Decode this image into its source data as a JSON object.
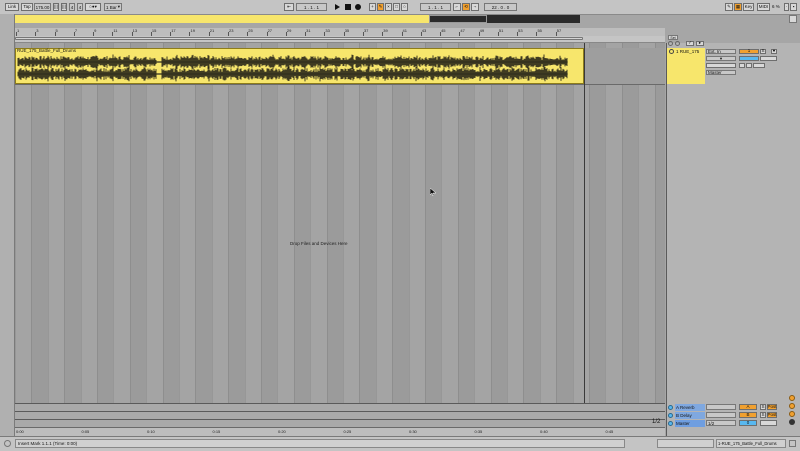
{
  "transport": {
    "link_label": "Link",
    "tap_label": "Tap",
    "tempo": "175.00",
    "sig_num": "4",
    "sig_den": "4",
    "quantize": "1 Bar",
    "position": "1 . 1 . 1",
    "loop_start": "1 . 1 . 1",
    "loop_length": "22 . 0 . 0",
    "key_label": "Key",
    "midi_label": "MIDI",
    "cpu": "6 %"
  },
  "ruler": {
    "bars": [
      "1",
      "3",
      "5",
      "7",
      "9",
      "11",
      "13",
      "15",
      "17",
      "19",
      "21",
      "23",
      "25",
      "27",
      "29",
      "31",
      "33",
      "35",
      "37",
      "39",
      "41",
      "43",
      "45",
      "47",
      "49",
      "51",
      "53",
      "55",
      "57"
    ]
  },
  "clip": {
    "name": "RUE_175_Battle_Full_Drums"
  },
  "track": {
    "name": "1 RUE_175",
    "input": "Ext. In",
    "output": "Master",
    "number": "1",
    "solo": "S"
  },
  "arrangement": {
    "drop_hint": "Drop Files and Devices Here"
  },
  "returns": [
    {
      "name": "A Reverb",
      "letter": "A"
    },
    {
      "name": "B Delay",
      "letter": "B"
    },
    {
      "name": "Master",
      "letter": "0"
    }
  ],
  "master": {
    "cue": "1/2",
    "fraction": "1/2"
  },
  "time_ruler": {
    "labels": [
      "0:00",
      "0:05",
      "0:10",
      "0:15",
      "0:20",
      "0:25",
      "0:30",
      "0:35",
      "0:40",
      "0:45"
    ]
  },
  "status": {
    "message": "Insert Mark 1.1.1 (Time: 0:00)",
    "selected_clip": "1-RUE_175_Battle_Full_Drums"
  },
  "colors": {
    "clip": "#f7e66c",
    "accent_orange": "#f0a030",
    "accent_blue": "#58b8f0",
    "background": "#a6a6a6"
  }
}
